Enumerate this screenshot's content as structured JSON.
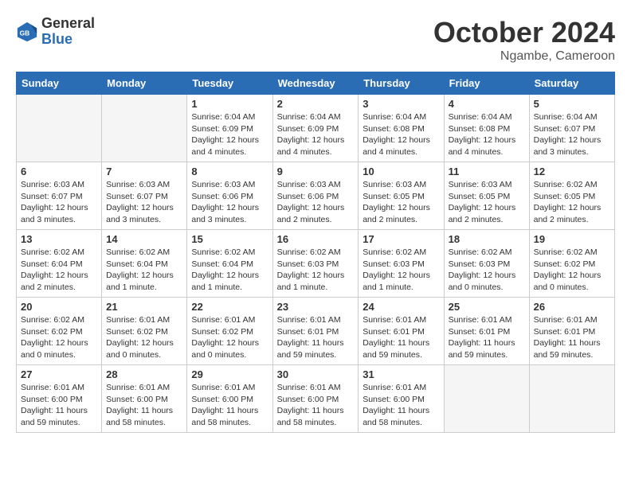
{
  "header": {
    "logo": {
      "general": "General",
      "blue": "Blue"
    },
    "title": "October 2024",
    "location": "Ngambe, Cameroon"
  },
  "weekdays": [
    "Sunday",
    "Monday",
    "Tuesday",
    "Wednesday",
    "Thursday",
    "Friday",
    "Saturday"
  ],
  "weeks": [
    [
      {
        "day": "",
        "info": ""
      },
      {
        "day": "",
        "info": ""
      },
      {
        "day": "1",
        "info": "Sunrise: 6:04 AM\nSunset: 6:09 PM\nDaylight: 12 hours\nand 4 minutes."
      },
      {
        "day": "2",
        "info": "Sunrise: 6:04 AM\nSunset: 6:09 PM\nDaylight: 12 hours\nand 4 minutes."
      },
      {
        "day": "3",
        "info": "Sunrise: 6:04 AM\nSunset: 6:08 PM\nDaylight: 12 hours\nand 4 minutes."
      },
      {
        "day": "4",
        "info": "Sunrise: 6:04 AM\nSunset: 6:08 PM\nDaylight: 12 hours\nand 4 minutes."
      },
      {
        "day": "5",
        "info": "Sunrise: 6:04 AM\nSunset: 6:07 PM\nDaylight: 12 hours\nand 3 minutes."
      }
    ],
    [
      {
        "day": "6",
        "info": "Sunrise: 6:03 AM\nSunset: 6:07 PM\nDaylight: 12 hours\nand 3 minutes."
      },
      {
        "day": "7",
        "info": "Sunrise: 6:03 AM\nSunset: 6:07 PM\nDaylight: 12 hours\nand 3 minutes."
      },
      {
        "day": "8",
        "info": "Sunrise: 6:03 AM\nSunset: 6:06 PM\nDaylight: 12 hours\nand 3 minutes."
      },
      {
        "day": "9",
        "info": "Sunrise: 6:03 AM\nSunset: 6:06 PM\nDaylight: 12 hours\nand 2 minutes."
      },
      {
        "day": "10",
        "info": "Sunrise: 6:03 AM\nSunset: 6:05 PM\nDaylight: 12 hours\nand 2 minutes."
      },
      {
        "day": "11",
        "info": "Sunrise: 6:03 AM\nSunset: 6:05 PM\nDaylight: 12 hours\nand 2 minutes."
      },
      {
        "day": "12",
        "info": "Sunrise: 6:02 AM\nSunset: 6:05 PM\nDaylight: 12 hours\nand 2 minutes."
      }
    ],
    [
      {
        "day": "13",
        "info": "Sunrise: 6:02 AM\nSunset: 6:04 PM\nDaylight: 12 hours\nand 2 minutes."
      },
      {
        "day": "14",
        "info": "Sunrise: 6:02 AM\nSunset: 6:04 PM\nDaylight: 12 hours\nand 1 minute."
      },
      {
        "day": "15",
        "info": "Sunrise: 6:02 AM\nSunset: 6:04 PM\nDaylight: 12 hours\nand 1 minute."
      },
      {
        "day": "16",
        "info": "Sunrise: 6:02 AM\nSunset: 6:03 PM\nDaylight: 12 hours\nand 1 minute."
      },
      {
        "day": "17",
        "info": "Sunrise: 6:02 AM\nSunset: 6:03 PM\nDaylight: 12 hours\nand 1 minute."
      },
      {
        "day": "18",
        "info": "Sunrise: 6:02 AM\nSunset: 6:03 PM\nDaylight: 12 hours\nand 0 minutes."
      },
      {
        "day": "19",
        "info": "Sunrise: 6:02 AM\nSunset: 6:02 PM\nDaylight: 12 hours\nand 0 minutes."
      }
    ],
    [
      {
        "day": "20",
        "info": "Sunrise: 6:02 AM\nSunset: 6:02 PM\nDaylight: 12 hours\nand 0 minutes."
      },
      {
        "day": "21",
        "info": "Sunrise: 6:01 AM\nSunset: 6:02 PM\nDaylight: 12 hours\nand 0 minutes."
      },
      {
        "day": "22",
        "info": "Sunrise: 6:01 AM\nSunset: 6:02 PM\nDaylight: 12 hours\nand 0 minutes."
      },
      {
        "day": "23",
        "info": "Sunrise: 6:01 AM\nSunset: 6:01 PM\nDaylight: 11 hours\nand 59 minutes."
      },
      {
        "day": "24",
        "info": "Sunrise: 6:01 AM\nSunset: 6:01 PM\nDaylight: 11 hours\nand 59 minutes."
      },
      {
        "day": "25",
        "info": "Sunrise: 6:01 AM\nSunset: 6:01 PM\nDaylight: 11 hours\nand 59 minutes."
      },
      {
        "day": "26",
        "info": "Sunrise: 6:01 AM\nSunset: 6:01 PM\nDaylight: 11 hours\nand 59 minutes."
      }
    ],
    [
      {
        "day": "27",
        "info": "Sunrise: 6:01 AM\nSunset: 6:00 PM\nDaylight: 11 hours\nand 59 minutes."
      },
      {
        "day": "28",
        "info": "Sunrise: 6:01 AM\nSunset: 6:00 PM\nDaylight: 11 hours\nand 58 minutes."
      },
      {
        "day": "29",
        "info": "Sunrise: 6:01 AM\nSunset: 6:00 PM\nDaylight: 11 hours\nand 58 minutes."
      },
      {
        "day": "30",
        "info": "Sunrise: 6:01 AM\nSunset: 6:00 PM\nDaylight: 11 hours\nand 58 minutes."
      },
      {
        "day": "31",
        "info": "Sunrise: 6:01 AM\nSunset: 6:00 PM\nDaylight: 11 hours\nand 58 minutes."
      },
      {
        "day": "",
        "info": ""
      },
      {
        "day": "",
        "info": ""
      }
    ]
  ]
}
